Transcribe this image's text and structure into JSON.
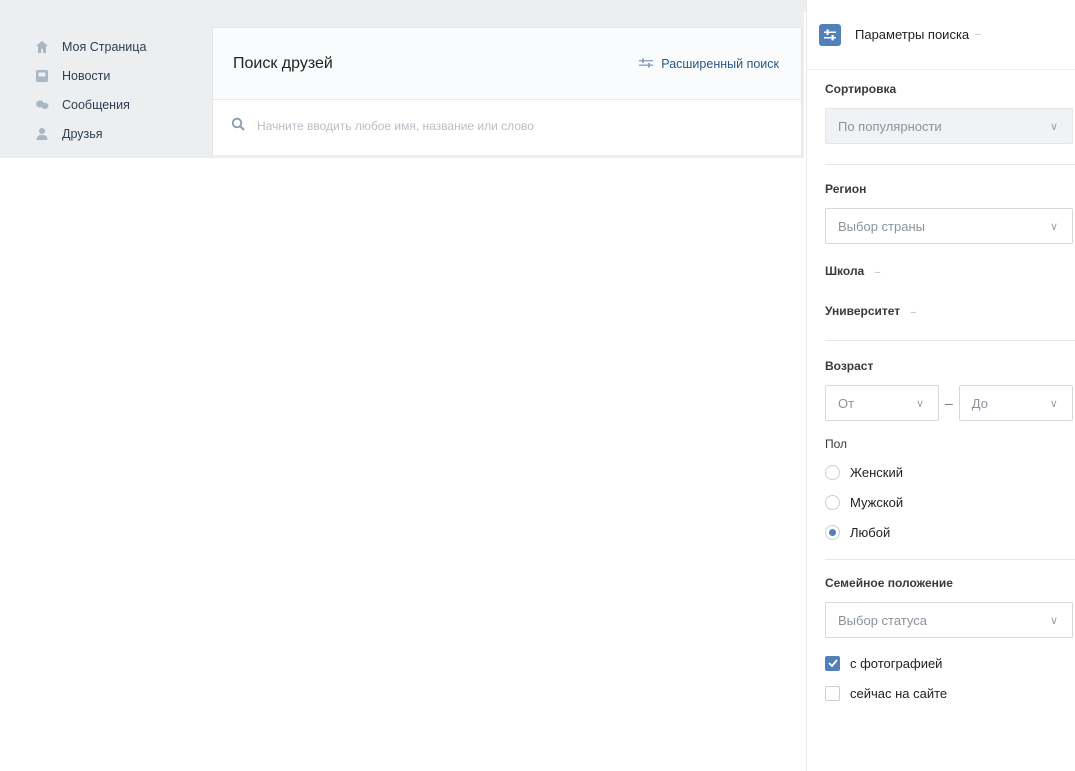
{
  "nav": {
    "items": [
      {
        "label": "Моя Страница",
        "icon": "home-icon"
      },
      {
        "label": "Новости",
        "icon": "news-icon"
      },
      {
        "label": "Сообщения",
        "icon": "messages-icon"
      },
      {
        "label": "Друзья",
        "icon": "friends-icon"
      }
    ]
  },
  "main": {
    "title": "Поиск друзей",
    "advanced_search": "Расширенный поиск",
    "search_placeholder": "Начните вводить любое имя, название или слово"
  },
  "filters": {
    "title": "Параметры поиска",
    "sort": {
      "label": "Сортировка",
      "value": "По популярности"
    },
    "region": {
      "label": "Регион",
      "value": "Выбор страны"
    },
    "school": "Школа",
    "university": "Университет",
    "age": {
      "label": "Возраст",
      "from": "От",
      "dash": "–",
      "to": "До"
    },
    "gender": {
      "label": "Пол",
      "options": [
        {
          "label": "Женский",
          "selected": false
        },
        {
          "label": "Мужской",
          "selected": false
        },
        {
          "label": "Любой",
          "selected": true
        }
      ]
    },
    "family": {
      "label": "Семейное положение",
      "value": "Выбор статуса"
    },
    "with_photo": {
      "label": "с фотографией",
      "checked": true
    },
    "online": {
      "label": "сейчас на сайте",
      "checked": false
    }
  },
  "colors": {
    "accent": "#5181b8",
    "link": "#2a5885",
    "bg": "#edeef0"
  }
}
